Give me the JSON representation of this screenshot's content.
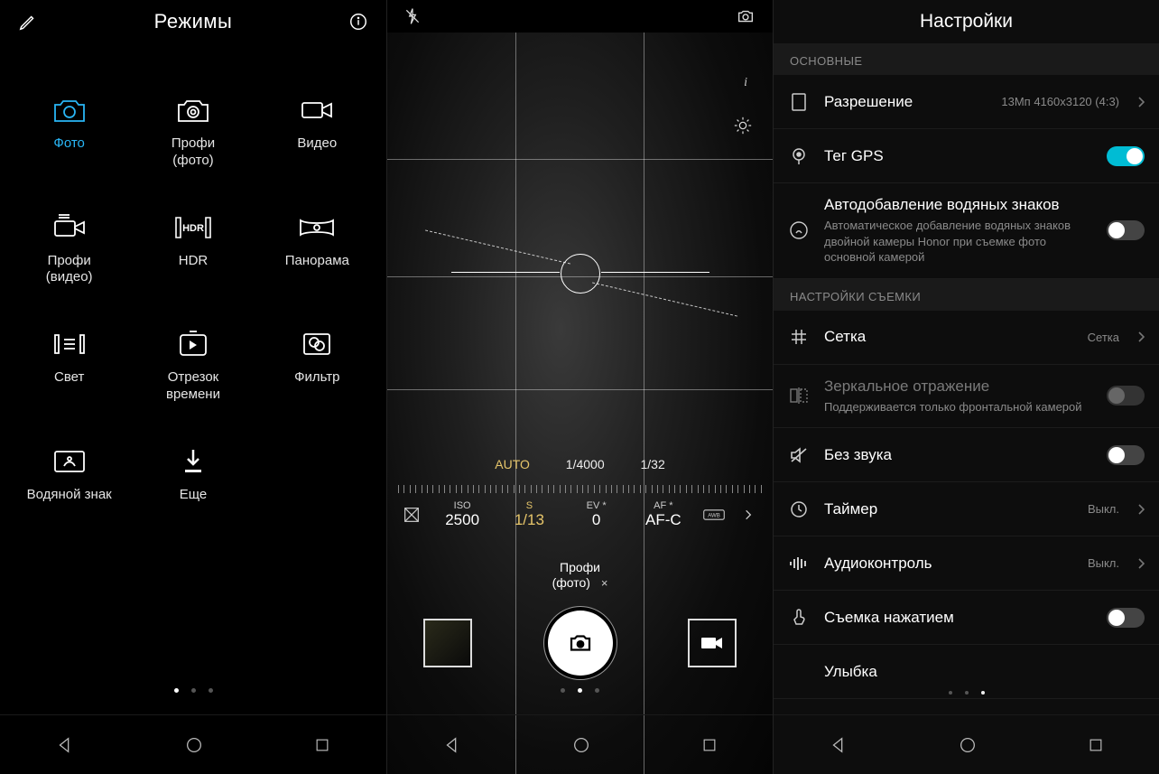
{
  "panel1": {
    "title": "Режимы",
    "modes": [
      {
        "label": "Фото",
        "icon": "camera",
        "active": true
      },
      {
        "label": "Профи\n(фото)",
        "icon": "camera-pro"
      },
      {
        "label": "Видео",
        "icon": "video"
      },
      {
        "label": "Профи\n(видео)",
        "icon": "video-pro"
      },
      {
        "label": "HDR",
        "icon": "hdr"
      },
      {
        "label": "Панорама",
        "icon": "panorama"
      },
      {
        "label": "Свет",
        "icon": "light"
      },
      {
        "label": "Отрезок\nвремени",
        "icon": "timelapse"
      },
      {
        "label": "Фильтр",
        "icon": "filter"
      },
      {
        "label": "Водяной знак",
        "icon": "watermark"
      },
      {
        "label": "Еще",
        "icon": "download"
      }
    ],
    "dots_active": 0
  },
  "panel2": {
    "readout": {
      "auto": "AUTO",
      "shutter_fast": "1/4000",
      "aperture": "1/32"
    },
    "controls": {
      "iso_label": "ISO",
      "iso_value": "2500",
      "s_label": "S",
      "s_value": "1/13",
      "ev_label": "EV",
      "ev_star": "*",
      "ev_value": "0",
      "af_label": "AF",
      "af_star": "*",
      "af_value": "AF-C"
    },
    "mode_pill": "Профи\n(фото)",
    "dots_active": 1,
    "info_letter": "i"
  },
  "panel3": {
    "title": "Настройки",
    "sections": [
      {
        "header": "ОСНОВНЫЕ"
      },
      {
        "header": "НАСТРОЙКИ СЪЕМКИ"
      }
    ],
    "items": [
      {
        "section": 0,
        "icon": "rect",
        "title": "Разрешение",
        "value": "13Мп 4160x3120 (4:3)",
        "type": "link"
      },
      {
        "section": 0,
        "icon": "pin",
        "title": "Тег GPS",
        "type": "toggle",
        "on": true
      },
      {
        "section": 0,
        "icon": "stamp",
        "title": "Автодобавление водяных знаков",
        "sub": "Автоматическое добавление водяных знаков двойной камеры Honor при съемке фото основной камерой",
        "type": "toggle",
        "on": false
      },
      {
        "section": 1,
        "icon": "grid",
        "title": "Сетка",
        "value": "Сетка",
        "type": "link"
      },
      {
        "section": 1,
        "icon": "mirror",
        "title": "Зеркальное отражение",
        "sub": "Поддерживается только фронтальной камерой",
        "type": "toggle",
        "disabled": true
      },
      {
        "section": 1,
        "icon": "mute",
        "title": "Без звука",
        "type": "toggle",
        "on": false
      },
      {
        "section": 1,
        "icon": "clock",
        "title": "Таймер",
        "value": "Выкл.",
        "type": "link"
      },
      {
        "section": 1,
        "icon": "audio",
        "title": "Аудиоконтроль",
        "value": "Выкл.",
        "type": "link"
      },
      {
        "section": 1,
        "icon": "touch",
        "title": "Съемка нажатием",
        "type": "toggle",
        "on": false
      },
      {
        "section": 1,
        "icon": "",
        "title": "Улыбка",
        "type": "plain"
      }
    ],
    "dots_active": 2
  }
}
